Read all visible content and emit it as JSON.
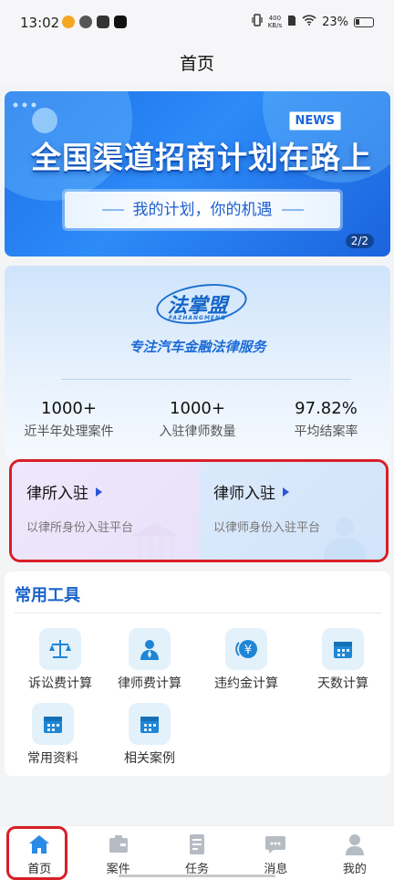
{
  "status_bar": {
    "time": "13:02",
    "net_speed_value": "400",
    "net_speed_unit": "KB/s",
    "battery": "23%"
  },
  "nav": {
    "title": "首页"
  },
  "banner": {
    "badge": "NEWS",
    "headline": "全国渠道招商计划在路上",
    "subline": "我的计划，你的机遇",
    "pager": "2/2"
  },
  "intro": {
    "logo_text": "法掌盟",
    "logo_en": "FAZHANGMENG",
    "slogan": "专注汽车金融法律服务",
    "stats": [
      {
        "value": "1000+",
        "label": "近半年处理案件"
      },
      {
        "value": "1000+",
        "label": "入驻律师数量"
      },
      {
        "value": "97.82%",
        "label": "平均结案率"
      }
    ]
  },
  "join": {
    "firm": {
      "title": "律所入驻",
      "desc": "以律所身份入驻平台"
    },
    "lawyer": {
      "title": "律师入驻",
      "desc": "以律师身份入驻平台"
    }
  },
  "tools": {
    "title": "常用工具",
    "items": [
      {
        "label": "诉讼费计算",
        "icon": "scale-icon"
      },
      {
        "label": "律师费计算",
        "icon": "lawyer-icon"
      },
      {
        "label": "违约金计算",
        "icon": "yen-coin-icon"
      },
      {
        "label": "天数计算",
        "icon": "calendar-icon"
      },
      {
        "label": "常用资料",
        "icon": "calendar-icon"
      },
      {
        "label": "相关案例",
        "icon": "calendar-icon"
      }
    ]
  },
  "tabbar": {
    "items": [
      {
        "label": "首页",
        "icon": "home-icon"
      },
      {
        "label": "案件",
        "icon": "case-icon"
      },
      {
        "label": "任务",
        "icon": "task-icon"
      },
      {
        "label": "消息",
        "icon": "message-icon"
      },
      {
        "label": "我的",
        "icon": "profile-icon"
      }
    ]
  },
  "colors": {
    "accent": "#1b64c8",
    "highlight_frame": "#d81f26",
    "active_tab": "#2a8be6",
    "inactive_tab": "#b6bcc4"
  }
}
